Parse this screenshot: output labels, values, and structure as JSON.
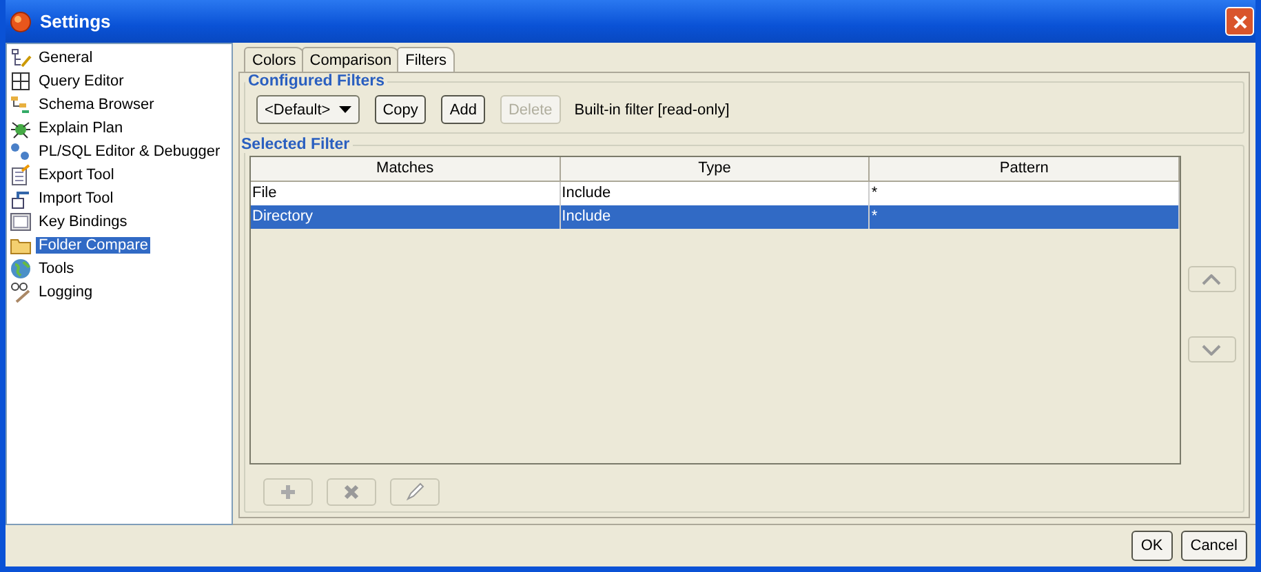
{
  "window": {
    "title": "Settings"
  },
  "sidebar": {
    "items": [
      {
        "label": "General",
        "selected": false
      },
      {
        "label": "Query Editor",
        "selected": false
      },
      {
        "label": "Schema Browser",
        "selected": false
      },
      {
        "label": "Explain Plan",
        "selected": false
      },
      {
        "label": "PL/SQL Editor & Debugger",
        "selected": false
      },
      {
        "label": "Export Tool",
        "selected": false
      },
      {
        "label": "Import Tool",
        "selected": false
      },
      {
        "label": "Key Bindings",
        "selected": false
      },
      {
        "label": "Folder Compare",
        "selected": true
      },
      {
        "label": "Tools",
        "selected": false
      },
      {
        "label": "Logging",
        "selected": false
      }
    ]
  },
  "tabs": [
    {
      "label": "Colors",
      "selected": false
    },
    {
      "label": "Comparison",
      "selected": false
    },
    {
      "label": "Filters",
      "selected": true
    }
  ],
  "configured_filters": {
    "title": "Configured Filters",
    "dropdown": "<Default>",
    "buttons": [
      {
        "label": "Copy",
        "disabled": false
      },
      {
        "label": "Add",
        "disabled": false
      },
      {
        "label": "Delete",
        "disabled": true
      }
    ],
    "note": "Built-in filter [read-only]"
  },
  "selected_filter": {
    "title": "Selected Filter",
    "table": {
      "columns": [
        "Matches",
        "Type",
        "Pattern"
      ],
      "rows": [
        {
          "cells": [
            "File",
            "Include",
            "*"
          ],
          "selected": false
        },
        {
          "cells": [
            "Directory",
            "Include",
            "*"
          ],
          "selected": true
        }
      ]
    },
    "row_buttons": [
      {
        "kind": "add",
        "disabled": true
      },
      {
        "kind": "remove",
        "disabled": true
      },
      {
        "kind": "edit",
        "disabled": true
      }
    ],
    "move_buttons": [
      {
        "kind": "up",
        "disabled": true
      },
      {
        "kind": "down",
        "disabled": true
      }
    ]
  },
  "buttons": [
    "OK",
    "Cancel"
  ]
}
